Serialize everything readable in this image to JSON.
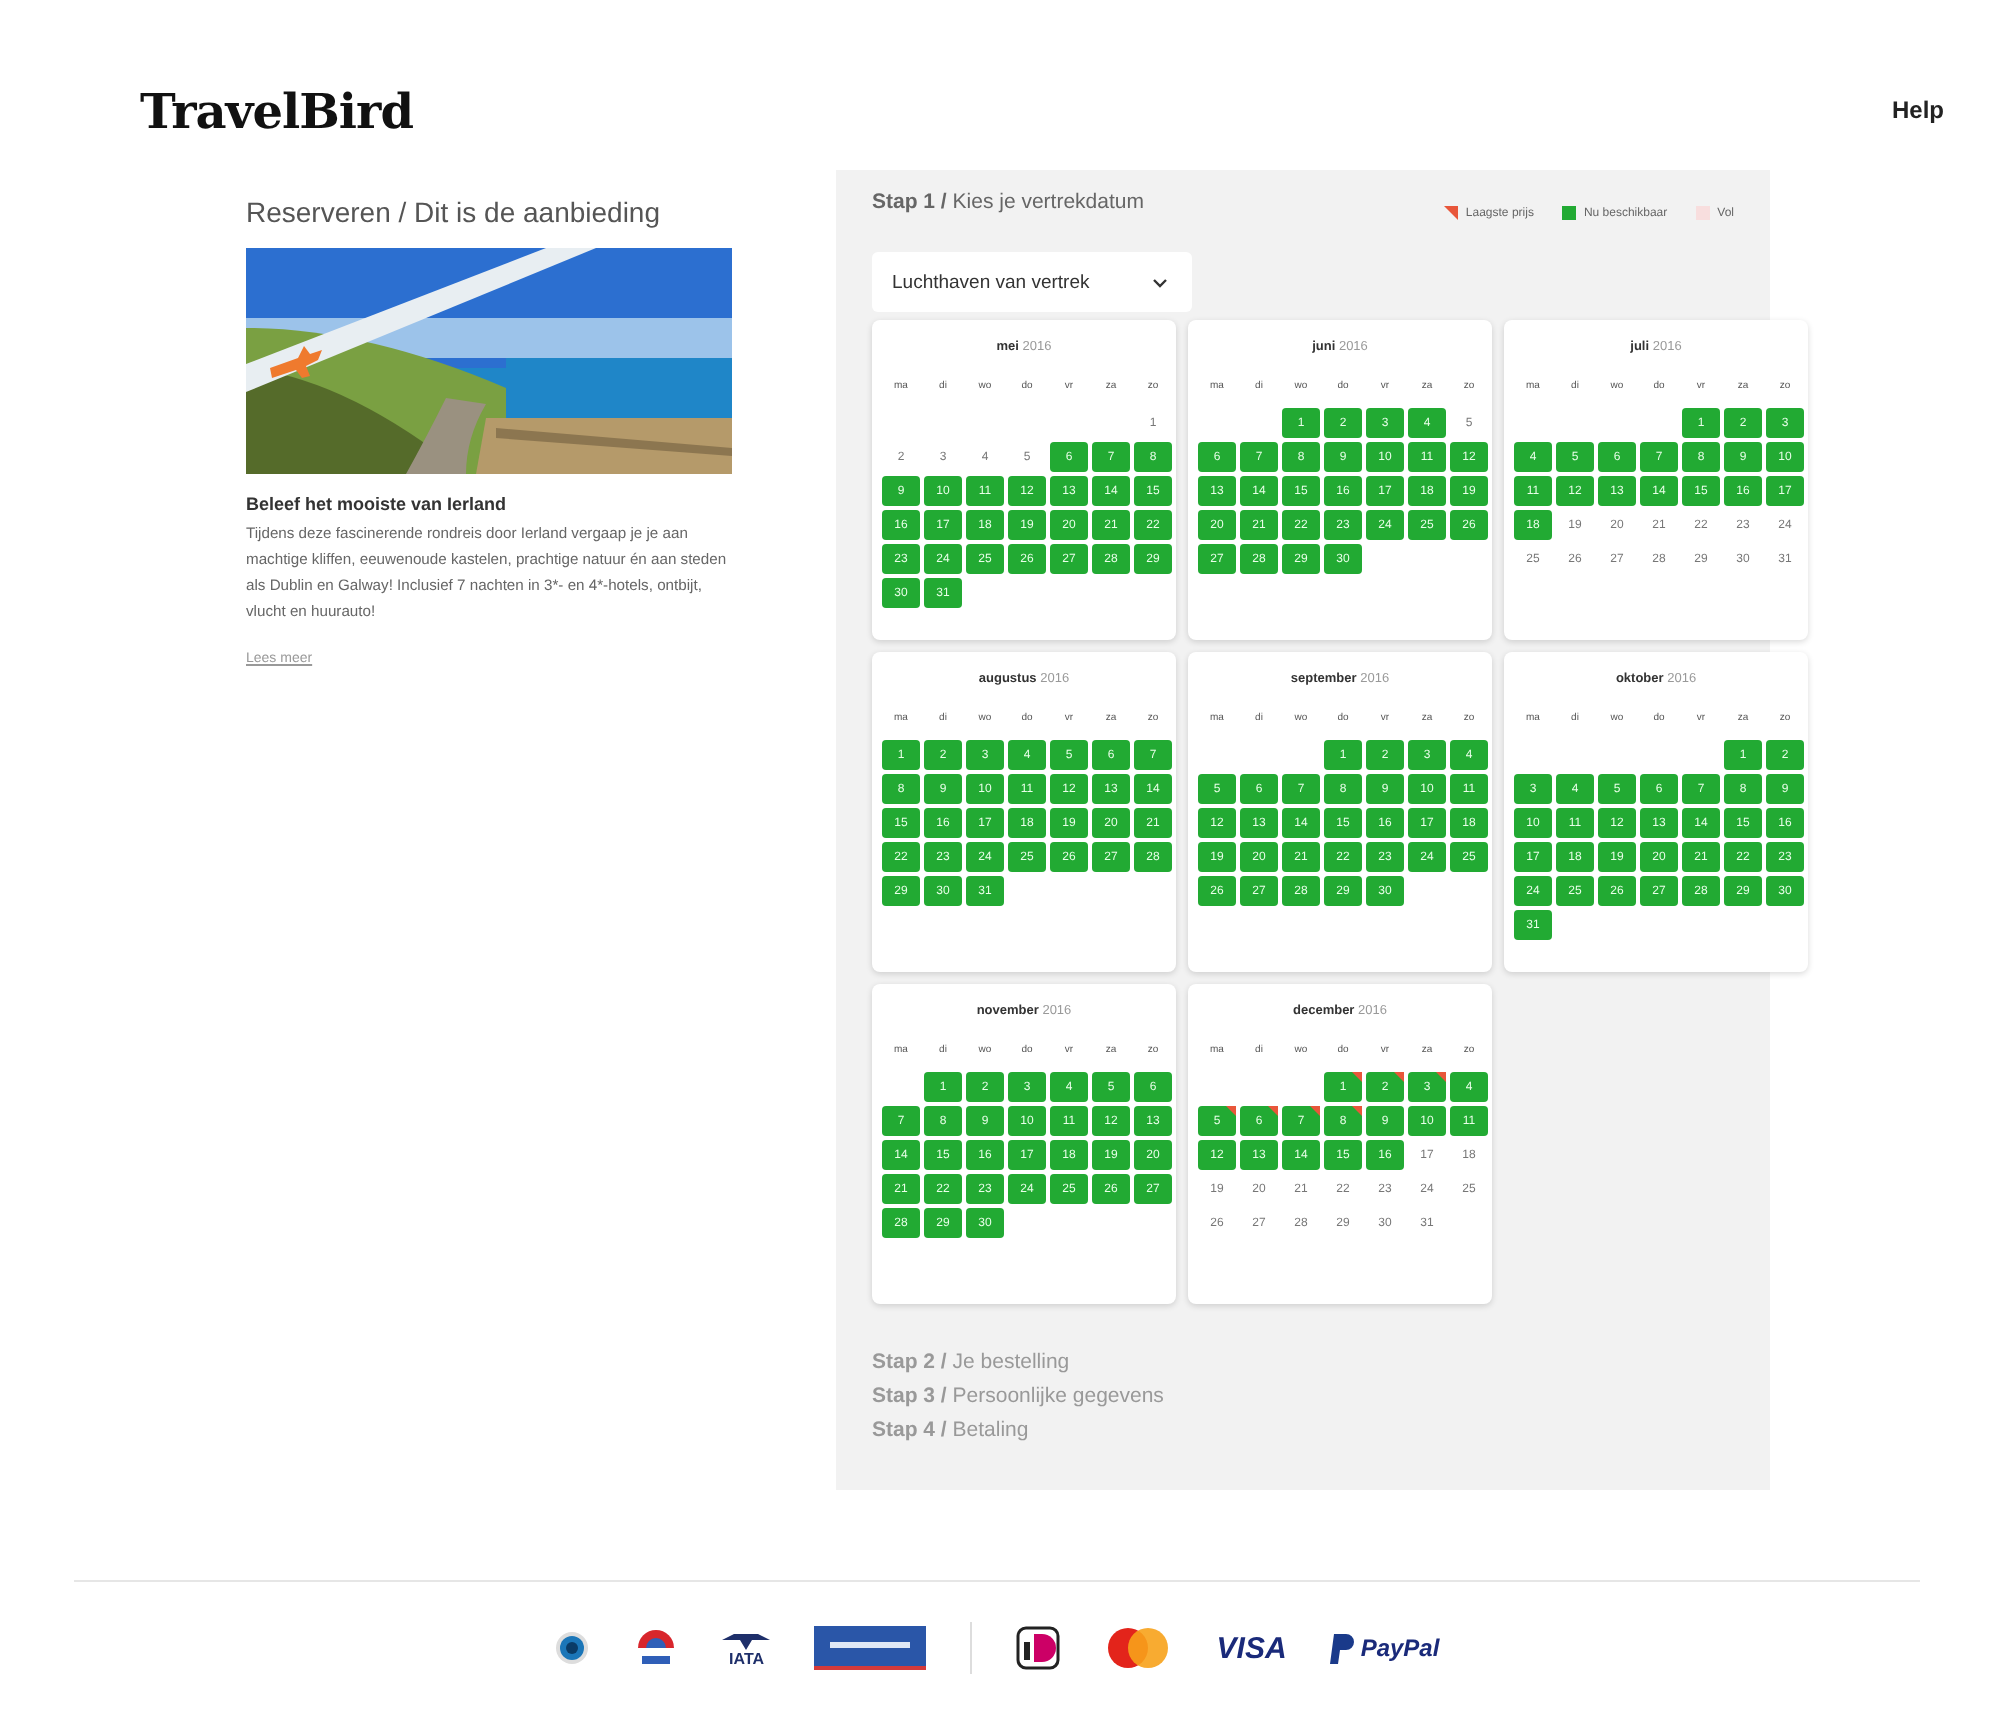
{
  "header": {
    "logo": "TravelBird",
    "help": "Help"
  },
  "offer": {
    "breadcrumb": "Reserveren / Dit is de aanbieding",
    "title": "Beleef het mooiste van Ierland",
    "description": "Tijdens deze fascinerende rondreis door Ierland vergaap je je aan machtige kliffen, eeuwenoude kastelen, prachtige natuur én aan steden als Dublin en Galway! Inclusief 7 nachten in 3*- en 4*-hotels, ontbijt, vlucht en huurauto!",
    "read_more": "Lees meer"
  },
  "step1": {
    "label": "Stap 1 /",
    "title": "Kies je vertrekdatum"
  },
  "legend": [
    {
      "kind": "lowest",
      "label": "Laagste prijs"
    },
    {
      "kind": "available",
      "label": "Nu beschikbaar"
    },
    {
      "kind": "full",
      "label": "Vol"
    }
  ],
  "airport_select": {
    "value": "Luchthaven van vertrek"
  },
  "months": [
    {
      "name": "mei",
      "year": "2016",
      "weekdays": [
        "ma",
        "di",
        "wo",
        "do",
        "vr",
        "za",
        "zo"
      ],
      "weeks": [
        [
          {
            "kind": "blank"
          },
          {
            "kind": "blank"
          },
          {
            "kind": "blank"
          },
          {
            "kind": "blank"
          },
          {
            "kind": "blank"
          },
          {
            "kind": "blank"
          },
          {
            "day": "1",
            "available": false,
            "lowest_price": false
          }
        ],
        [
          {
            "day": "2",
            "available": false,
            "lowest_price": false
          },
          {
            "day": "3",
            "available": false,
            "lowest_price": false
          },
          {
            "day": "4",
            "available": false,
            "lowest_price": false
          },
          {
            "day": "5",
            "available": false,
            "lowest_price": false
          },
          {
            "day": "6",
            "available": true,
            "lowest_price": false
          },
          {
            "day": "7",
            "available": true,
            "lowest_price": false
          },
          {
            "day": "8",
            "available": true,
            "lowest_price": false
          }
        ],
        [
          {
            "day": "9",
            "available": true,
            "lowest_price": false
          },
          {
            "day": "10",
            "available": true,
            "lowest_price": false
          },
          {
            "day": "11",
            "available": true,
            "lowest_price": false
          },
          {
            "day": "12",
            "available": true,
            "lowest_price": false
          },
          {
            "day": "13",
            "available": true,
            "lowest_price": false
          },
          {
            "day": "14",
            "available": true,
            "lowest_price": false
          },
          {
            "day": "15",
            "available": true,
            "lowest_price": false
          }
        ],
        [
          {
            "day": "16",
            "available": true,
            "lowest_price": false
          },
          {
            "day": "17",
            "available": true,
            "lowest_price": false
          },
          {
            "day": "18",
            "available": true,
            "lowest_price": false
          },
          {
            "day": "19",
            "available": true,
            "lowest_price": false
          },
          {
            "day": "20",
            "available": true,
            "lowest_price": false
          },
          {
            "day": "21",
            "available": true,
            "lowest_price": false
          },
          {
            "day": "22",
            "available": true,
            "lowest_price": false
          }
        ],
        [
          {
            "day": "23",
            "available": true,
            "lowest_price": false
          },
          {
            "day": "24",
            "available": true,
            "lowest_price": false
          },
          {
            "day": "25",
            "available": true,
            "lowest_price": false
          },
          {
            "day": "26",
            "available": true,
            "lowest_price": false
          },
          {
            "day": "27",
            "available": true,
            "lowest_price": false
          },
          {
            "day": "28",
            "available": true,
            "lowest_price": false
          },
          {
            "day": "29",
            "available": true,
            "lowest_price": false
          }
        ],
        [
          {
            "day": "30",
            "available": true,
            "lowest_price": false
          },
          {
            "day": "31",
            "available": true,
            "lowest_price": false
          }
        ]
      ]
    },
    {
      "name": "juni",
      "year": "2016",
      "weekdays": [
        "ma",
        "di",
        "wo",
        "do",
        "vr",
        "za",
        "zo"
      ],
      "weeks": [
        [
          {
            "kind": "blank"
          },
          {
            "kind": "blank"
          },
          {
            "day": "1",
            "available": true,
            "lowest_price": false
          },
          {
            "day": "2",
            "available": true,
            "lowest_price": false
          },
          {
            "day": "3",
            "available": true,
            "lowest_price": false
          },
          {
            "day": "4",
            "available": true,
            "lowest_price": false
          },
          {
            "day": "5",
            "available": false,
            "lowest_price": false
          }
        ],
        [
          {
            "day": "6",
            "available": true,
            "lowest_price": false
          },
          {
            "day": "7",
            "available": true,
            "lowest_price": false
          },
          {
            "day": "8",
            "available": true,
            "lowest_price": false
          },
          {
            "day": "9",
            "available": true,
            "lowest_price": false
          },
          {
            "day": "10",
            "available": true,
            "lowest_price": false
          },
          {
            "day": "11",
            "available": true,
            "lowest_price": false
          },
          {
            "day": "12",
            "available": true,
            "lowest_price": false
          }
        ],
        [
          {
            "day": "13",
            "available": true,
            "lowest_price": false
          },
          {
            "day": "14",
            "available": true,
            "lowest_price": false
          },
          {
            "day": "15",
            "available": true,
            "lowest_price": false
          },
          {
            "day": "16",
            "available": true,
            "lowest_price": false
          },
          {
            "day": "17",
            "available": true,
            "lowest_price": false
          },
          {
            "day": "18",
            "available": true,
            "lowest_price": false
          },
          {
            "day": "19",
            "available": true,
            "lowest_price": false
          }
        ],
        [
          {
            "day": "20",
            "available": true,
            "lowest_price": false
          },
          {
            "day": "21",
            "available": true,
            "lowest_price": false
          },
          {
            "day": "22",
            "available": true,
            "lowest_price": false
          },
          {
            "day": "23",
            "available": true,
            "lowest_price": false
          },
          {
            "day": "24",
            "available": true,
            "lowest_price": false
          },
          {
            "day": "25",
            "available": true,
            "lowest_price": false
          },
          {
            "day": "26",
            "available": true,
            "lowest_price": false
          }
        ],
        [
          {
            "day": "27",
            "available": true,
            "lowest_price": false
          },
          {
            "day": "28",
            "available": true,
            "lowest_price": false
          },
          {
            "day": "29",
            "available": true,
            "lowest_price": false
          },
          {
            "day": "30",
            "available": true,
            "lowest_price": false
          }
        ]
      ]
    },
    {
      "name": "juli",
      "year": "2016",
      "weekdays": [
        "ma",
        "di",
        "wo",
        "do",
        "vr",
        "za",
        "zo"
      ],
      "weeks": [
        [
          {
            "kind": "blank"
          },
          {
            "kind": "blank"
          },
          {
            "kind": "blank"
          },
          {
            "kind": "blank"
          },
          {
            "day": "1",
            "available": true,
            "lowest_price": false
          },
          {
            "day": "2",
            "available": true,
            "lowest_price": false
          },
          {
            "day": "3",
            "available": true,
            "lowest_price": false
          }
        ],
        [
          {
            "day": "4",
            "available": true,
            "lowest_price": false
          },
          {
            "day": "5",
            "available": true,
            "lowest_price": false
          },
          {
            "day": "6",
            "available": true,
            "lowest_price": false
          },
          {
            "day": "7",
            "available": true,
            "lowest_price": false
          },
          {
            "day": "8",
            "available": true,
            "lowest_price": false
          },
          {
            "day": "9",
            "available": true,
            "lowest_price": false
          },
          {
            "day": "10",
            "available": true,
            "lowest_price": false
          }
        ],
        [
          {
            "day": "11",
            "available": true,
            "lowest_price": false
          },
          {
            "day": "12",
            "available": true,
            "lowest_price": false
          },
          {
            "day": "13",
            "available": true,
            "lowest_price": false
          },
          {
            "day": "14",
            "available": true,
            "lowest_price": false
          },
          {
            "day": "15",
            "available": true,
            "lowest_price": false
          },
          {
            "day": "16",
            "available": true,
            "lowest_price": false
          },
          {
            "day": "17",
            "available": true,
            "lowest_price": false
          }
        ],
        [
          {
            "day": "18",
            "available": true,
            "lowest_price": false
          },
          {
            "day": "19",
            "available": false,
            "lowest_price": false
          },
          {
            "day": "20",
            "available": false,
            "lowest_price": false
          },
          {
            "day": "21",
            "available": false,
            "lowest_price": false
          },
          {
            "day": "22",
            "available": false,
            "lowest_price": false
          },
          {
            "day": "23",
            "available": false,
            "lowest_price": false
          },
          {
            "day": "24",
            "available": false,
            "lowest_price": false
          }
        ],
        [
          {
            "day": "25",
            "available": false,
            "lowest_price": false
          },
          {
            "day": "26",
            "available": false,
            "lowest_price": false
          },
          {
            "day": "27",
            "available": false,
            "lowest_price": false
          },
          {
            "day": "28",
            "available": false,
            "lowest_price": false
          },
          {
            "day": "29",
            "available": false,
            "lowest_price": false
          },
          {
            "day": "30",
            "available": false,
            "lowest_price": false
          },
          {
            "day": "31",
            "available": false,
            "lowest_price": false
          }
        ]
      ]
    },
    {
      "name": "augustus",
      "year": "2016",
      "weekdays": [
        "ma",
        "di",
        "wo",
        "do",
        "vr",
        "za",
        "zo"
      ],
      "weeks": [
        [
          {
            "day": "1",
            "available": true,
            "lowest_price": false
          },
          {
            "day": "2",
            "available": true,
            "lowest_price": false
          },
          {
            "day": "3",
            "available": true,
            "lowest_price": false
          },
          {
            "day": "4",
            "available": true,
            "lowest_price": false
          },
          {
            "day": "5",
            "available": true,
            "lowest_price": false
          },
          {
            "day": "6",
            "available": true,
            "lowest_price": false
          },
          {
            "day": "7",
            "available": true,
            "lowest_price": false
          }
        ],
        [
          {
            "day": "8",
            "available": true,
            "lowest_price": false
          },
          {
            "day": "9",
            "available": true,
            "lowest_price": false
          },
          {
            "day": "10",
            "available": true,
            "lowest_price": false
          },
          {
            "day": "11",
            "available": true,
            "lowest_price": false
          },
          {
            "day": "12",
            "available": true,
            "lowest_price": false
          },
          {
            "day": "13",
            "available": true,
            "lowest_price": false
          },
          {
            "day": "14",
            "available": true,
            "lowest_price": false
          }
        ],
        [
          {
            "day": "15",
            "available": true,
            "lowest_price": false
          },
          {
            "day": "16",
            "available": true,
            "lowest_price": false
          },
          {
            "day": "17",
            "available": true,
            "lowest_price": false
          },
          {
            "day": "18",
            "available": true,
            "lowest_price": false
          },
          {
            "day": "19",
            "available": true,
            "lowest_price": false
          },
          {
            "day": "20",
            "available": true,
            "lowest_price": false
          },
          {
            "day": "21",
            "available": true,
            "lowest_price": false
          }
        ],
        [
          {
            "day": "22",
            "available": true,
            "lowest_price": false
          },
          {
            "day": "23",
            "available": true,
            "lowest_price": false
          },
          {
            "day": "24",
            "available": true,
            "lowest_price": false
          },
          {
            "day": "25",
            "available": true,
            "lowest_price": false
          },
          {
            "day": "26",
            "available": true,
            "lowest_price": false
          },
          {
            "day": "27",
            "available": true,
            "lowest_price": false
          },
          {
            "day": "28",
            "available": true,
            "lowest_price": false
          }
        ],
        [
          {
            "day": "29",
            "available": true,
            "lowest_price": false
          },
          {
            "day": "30",
            "available": true,
            "lowest_price": false
          },
          {
            "day": "31",
            "available": true,
            "lowest_price": false
          }
        ]
      ]
    },
    {
      "name": "september",
      "year": "2016",
      "weekdays": [
        "ma",
        "di",
        "wo",
        "do",
        "vr",
        "za",
        "zo"
      ],
      "weeks": [
        [
          {
            "kind": "blank"
          },
          {
            "kind": "blank"
          },
          {
            "kind": "blank"
          },
          {
            "day": "1",
            "available": true,
            "lowest_price": false
          },
          {
            "day": "2",
            "available": true,
            "lowest_price": false
          },
          {
            "day": "3",
            "available": true,
            "lowest_price": false
          },
          {
            "day": "4",
            "available": true,
            "lowest_price": false
          }
        ],
        [
          {
            "day": "5",
            "available": true,
            "lowest_price": false
          },
          {
            "day": "6",
            "available": true,
            "lowest_price": false
          },
          {
            "day": "7",
            "available": true,
            "lowest_price": false
          },
          {
            "day": "8",
            "available": true,
            "lowest_price": false
          },
          {
            "day": "9",
            "available": true,
            "lowest_price": false
          },
          {
            "day": "10",
            "available": true,
            "lowest_price": false
          },
          {
            "day": "11",
            "available": true,
            "lowest_price": false
          }
        ],
        [
          {
            "day": "12",
            "available": true,
            "lowest_price": false
          },
          {
            "day": "13",
            "available": true,
            "lowest_price": false
          },
          {
            "day": "14",
            "available": true,
            "lowest_price": false
          },
          {
            "day": "15",
            "available": true,
            "lowest_price": false
          },
          {
            "day": "16",
            "available": true,
            "lowest_price": false
          },
          {
            "day": "17",
            "available": true,
            "lowest_price": false
          },
          {
            "day": "18",
            "available": true,
            "lowest_price": false
          }
        ],
        [
          {
            "day": "19",
            "available": true,
            "lowest_price": false
          },
          {
            "day": "20",
            "available": true,
            "lowest_price": false
          },
          {
            "day": "21",
            "available": true,
            "lowest_price": false
          },
          {
            "day": "22",
            "available": true,
            "lowest_price": false
          },
          {
            "day": "23",
            "available": true,
            "lowest_price": false
          },
          {
            "day": "24",
            "available": true,
            "lowest_price": false
          },
          {
            "day": "25",
            "available": true,
            "lowest_price": false
          }
        ],
        [
          {
            "day": "26",
            "available": true,
            "lowest_price": false
          },
          {
            "day": "27",
            "available": true,
            "lowest_price": false
          },
          {
            "day": "28",
            "available": true,
            "lowest_price": false
          },
          {
            "day": "29",
            "available": true,
            "lowest_price": false
          },
          {
            "day": "30",
            "available": true,
            "lowest_price": false
          }
        ]
      ]
    },
    {
      "name": "oktober",
      "year": "2016",
      "weekdays": [
        "ma",
        "di",
        "wo",
        "do",
        "vr",
        "za",
        "zo"
      ],
      "weeks": [
        [
          {
            "kind": "blank"
          },
          {
            "kind": "blank"
          },
          {
            "kind": "blank"
          },
          {
            "kind": "blank"
          },
          {
            "kind": "blank"
          },
          {
            "day": "1",
            "available": true,
            "lowest_price": false
          },
          {
            "day": "2",
            "available": true,
            "lowest_price": false
          }
        ],
        [
          {
            "day": "3",
            "available": true,
            "lowest_price": false
          },
          {
            "day": "4",
            "available": true,
            "lowest_price": false
          },
          {
            "day": "5",
            "available": true,
            "lowest_price": false
          },
          {
            "day": "6",
            "available": true,
            "lowest_price": false
          },
          {
            "day": "7",
            "available": true,
            "lowest_price": false
          },
          {
            "day": "8",
            "available": true,
            "lowest_price": false
          },
          {
            "day": "9",
            "available": true,
            "lowest_price": false
          }
        ],
        [
          {
            "day": "10",
            "available": true,
            "lowest_price": false
          },
          {
            "day": "11",
            "available": true,
            "lowest_price": false
          },
          {
            "day": "12",
            "available": true,
            "lowest_price": false
          },
          {
            "day": "13",
            "available": true,
            "lowest_price": false
          },
          {
            "day": "14",
            "available": true,
            "lowest_price": false
          },
          {
            "day": "15",
            "available": true,
            "lowest_price": false
          },
          {
            "day": "16",
            "available": true,
            "lowest_price": false
          }
        ],
        [
          {
            "day": "17",
            "available": true,
            "lowest_price": false
          },
          {
            "day": "18",
            "available": true,
            "lowest_price": false
          },
          {
            "day": "19",
            "available": true,
            "lowest_price": false
          },
          {
            "day": "20",
            "available": true,
            "lowest_price": false
          },
          {
            "day": "21",
            "available": true,
            "lowest_price": false
          },
          {
            "day": "22",
            "available": true,
            "lowest_price": false
          },
          {
            "day": "23",
            "available": true,
            "lowest_price": false
          }
        ],
        [
          {
            "day": "24",
            "available": true,
            "lowest_price": false
          },
          {
            "day": "25",
            "available": true,
            "lowest_price": false
          },
          {
            "day": "26",
            "available": true,
            "lowest_price": false
          },
          {
            "day": "27",
            "available": true,
            "lowest_price": false
          },
          {
            "day": "28",
            "available": true,
            "lowest_price": false
          },
          {
            "day": "29",
            "available": true,
            "lowest_price": false
          },
          {
            "day": "30",
            "available": true,
            "lowest_price": false
          }
        ],
        [
          {
            "day": "31",
            "available": true,
            "lowest_price": false
          }
        ]
      ]
    },
    {
      "name": "november",
      "year": "2016",
      "weekdays": [
        "ma",
        "di",
        "wo",
        "do",
        "vr",
        "za",
        "zo"
      ],
      "weeks": [
        [
          {
            "kind": "blank"
          },
          {
            "day": "1",
            "available": true,
            "lowest_price": false
          },
          {
            "day": "2",
            "available": true,
            "lowest_price": false
          },
          {
            "day": "3",
            "available": true,
            "lowest_price": false
          },
          {
            "day": "4",
            "available": true,
            "lowest_price": false
          },
          {
            "day": "5",
            "available": true,
            "lowest_price": false
          },
          {
            "day": "6",
            "available": true,
            "lowest_price": false
          }
        ],
        [
          {
            "day": "7",
            "available": true,
            "lowest_price": false
          },
          {
            "day": "8",
            "available": true,
            "lowest_price": false
          },
          {
            "day": "9",
            "available": true,
            "lowest_price": false
          },
          {
            "day": "10",
            "available": true,
            "lowest_price": false
          },
          {
            "day": "11",
            "available": true,
            "lowest_price": false
          },
          {
            "day": "12",
            "available": true,
            "lowest_price": false
          },
          {
            "day": "13",
            "available": true,
            "lowest_price": false
          }
        ],
        [
          {
            "day": "14",
            "available": true,
            "lowest_price": false
          },
          {
            "day": "15",
            "available": true,
            "lowest_price": false
          },
          {
            "day": "16",
            "available": true,
            "lowest_price": false
          },
          {
            "day": "17",
            "available": true,
            "lowest_price": false
          },
          {
            "day": "18",
            "available": true,
            "lowest_price": false
          },
          {
            "day": "19",
            "available": true,
            "lowest_price": false
          },
          {
            "day": "20",
            "available": true,
            "lowest_price": false
          }
        ],
        [
          {
            "day": "21",
            "available": true,
            "lowest_price": false
          },
          {
            "day": "22",
            "available": true,
            "lowest_price": false
          },
          {
            "day": "23",
            "available": true,
            "lowest_price": false
          },
          {
            "day": "24",
            "available": true,
            "lowest_price": false
          },
          {
            "day": "25",
            "available": true,
            "lowest_price": false
          },
          {
            "day": "26",
            "available": true,
            "lowest_price": false
          },
          {
            "day": "27",
            "available": true,
            "lowest_price": false
          }
        ],
        [
          {
            "day": "28",
            "available": true,
            "lowest_price": false
          },
          {
            "day": "29",
            "available": true,
            "lowest_price": false
          },
          {
            "day": "30",
            "available": true,
            "lowest_price": false
          }
        ]
      ]
    },
    {
      "name": "december",
      "year": "2016",
      "weekdays": [
        "ma",
        "di",
        "wo",
        "do",
        "vr",
        "za",
        "zo"
      ],
      "weeks": [
        [
          {
            "kind": "blank"
          },
          {
            "kind": "blank"
          },
          {
            "kind": "blank"
          },
          {
            "day": "1",
            "available": true,
            "lowest_price": true
          },
          {
            "day": "2",
            "available": true,
            "lowest_price": true
          },
          {
            "day": "3",
            "available": true,
            "lowest_price": true
          },
          {
            "day": "4",
            "available": true,
            "lowest_price": false
          }
        ],
        [
          {
            "day": "5",
            "available": true,
            "lowest_price": true
          },
          {
            "day": "6",
            "available": true,
            "lowest_price": true
          },
          {
            "day": "7",
            "available": true,
            "lowest_price": true
          },
          {
            "day": "8",
            "available": true,
            "lowest_price": true
          },
          {
            "day": "9",
            "available": true,
            "lowest_price": false
          },
          {
            "day": "10",
            "available": true,
            "lowest_price": false
          },
          {
            "day": "11",
            "available": true,
            "lowest_price": false
          }
        ],
        [
          {
            "day": "12",
            "available": true,
            "lowest_price": false
          },
          {
            "day": "13",
            "available": true,
            "lowest_price": false
          },
          {
            "day": "14",
            "available": true,
            "lowest_price": false
          },
          {
            "day": "15",
            "available": true,
            "lowest_price": false
          },
          {
            "day": "16",
            "available": true,
            "lowest_price": false
          },
          {
            "day": "17",
            "available": false,
            "lowest_price": false
          },
          {
            "day": "18",
            "available": false,
            "lowest_price": false
          }
        ],
        [
          {
            "day": "19",
            "available": false,
            "lowest_price": false
          },
          {
            "day": "20",
            "available": false,
            "lowest_price": false
          },
          {
            "day": "21",
            "available": false,
            "lowest_price": false
          },
          {
            "day": "22",
            "available": false,
            "lowest_price": false
          },
          {
            "day": "23",
            "available": false,
            "lowest_price": false
          },
          {
            "day": "24",
            "available": false,
            "lowest_price": false
          },
          {
            "day": "25",
            "available": false,
            "lowest_price": false
          }
        ],
        [
          {
            "day": "26",
            "available": false,
            "lowest_price": false
          },
          {
            "day": "27",
            "available": false,
            "lowest_price": false
          },
          {
            "day": "28",
            "available": false,
            "lowest_price": false
          },
          {
            "day": "29",
            "available": false,
            "lowest_price": false
          },
          {
            "day": "30",
            "available": false,
            "lowest_price": false
          },
          {
            "day": "31",
            "available": false,
            "lowest_price": false
          }
        ]
      ]
    }
  ],
  "next_steps": [
    {
      "label": "Stap 2 /",
      "title": "Je bestelling"
    },
    {
      "label": "Stap 3 /",
      "title": "Persoonlijke gegevens"
    },
    {
      "label": "Stap 4 /",
      "title": "Betaling"
    }
  ],
  "footer_logos": [
    {
      "kind": "globe"
    },
    {
      "kind": "sgr"
    },
    {
      "kind": "iata",
      "text": "IATA"
    },
    {
      "kind": "banner"
    },
    {
      "kind": "divider"
    },
    {
      "kind": "ideal"
    },
    {
      "kind": "mastercard"
    },
    {
      "kind": "visa",
      "text": "VISA"
    },
    {
      "kind": "paypal",
      "text": "PayPal"
    }
  ]
}
